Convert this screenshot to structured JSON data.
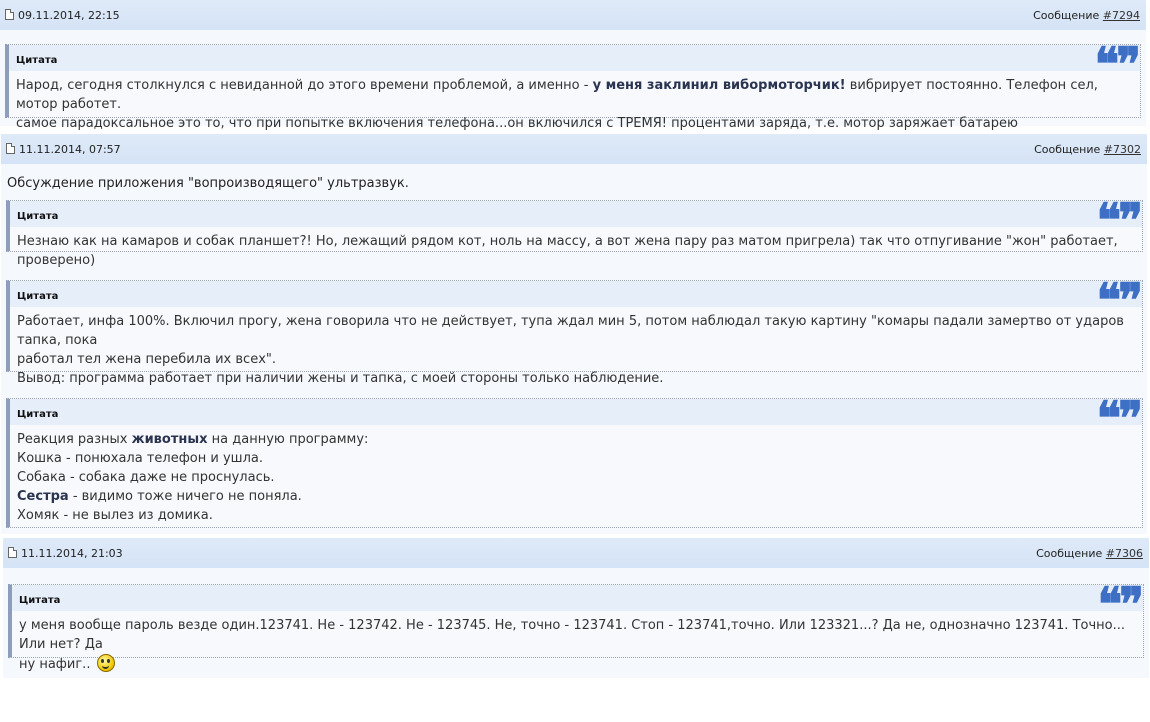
{
  "posts": [
    {
      "date": "09.11.2014, 22:15",
      "message_label": "Сообщение",
      "message_link": "#7294",
      "quotes": [
        {
          "label": "Цитата",
          "text_a": "Народ, сегодня столкнулся с невиданной до этого времени проблемой, а именно - ",
          "text_bold": "у меня заклинил вибормоторчик!",
          "text_b": " вибрирует постоянно. Телефон сел, мотор работет.",
          "text_c": "самое парадоксальное это то, что при попытке включения телефона...он включился с ТРЕМЯ! процентами заряда, т.е. мотор заряжает батарею"
        }
      ]
    },
    {
      "date": "11.11.2014, 07:57",
      "message_label": "Сообщение",
      "message_link": "#7302",
      "text": "Обсуждение приложения \"вопроизводящего\" ультразвук.",
      "quotes": [
        {
          "label": "Цитата",
          "text": "Незнаю как на камаров и собак планшет?! Но, лежащий рядом кот, ноль на массу, а вот жена пару раз матом пригрела) так что отпугивание \"жон\" работает, проверено)"
        },
        {
          "label": "Цитата",
          "line1": "Работает, инфа 100%. Включил прогу, жена говорила что не действует, тупа ждал мин 5, потом наблюдал такую картину \"комары падали замертво от ударов тапка, пока",
          "line2": "работал тел жена перебила их всех\".",
          "line3": "Вывод: программа работает при наличии жены и тапка, с моей стороны только наблюдение."
        },
        {
          "label": "Цитата",
          "line1_a": "Реакция разных ",
          "line1_bold": "животных",
          "line1_b": " на данную программу:",
          "line2": "Кошка - понюхала телефон и ушла.",
          "line3": "Собака - собака даже не проснулась.",
          "line4_bold": "Сестра",
          "line4": " - видимо тоже ничего не поняла.",
          "line5": "Хомяк - не вылез из домика."
        }
      ]
    },
    {
      "date": "11.11.2014, 21:03",
      "message_label": "Сообщение",
      "message_link": "#7306",
      "quotes": [
        {
          "label": "Цитата",
          "line1": "у меня вообще пароль везде один.123741. Не - 123742. Не - 123745. Не, точно - 123741. Стоп - 123741,точно. Или 123321...? Да не, однозначно 123741. Точно... Или нет? Да",
          "line2": "ну нафиг..",
          "emoticon": "smiley-icon"
        }
      ]
    }
  ],
  "quote_mark": "❝❞"
}
